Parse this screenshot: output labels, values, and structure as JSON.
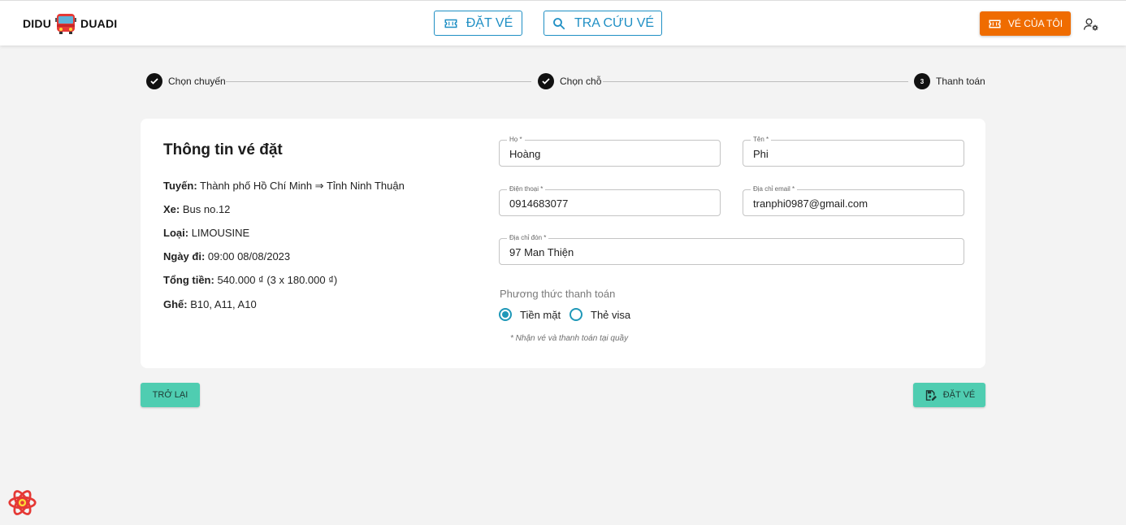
{
  "header": {
    "logo_left": "DIDU",
    "logo_right": "DUADI",
    "btn_book": "ĐẶT VÉ",
    "btn_lookup": "TRA CỨU VÉ",
    "btn_my_tickets": "VÉ CỦA TÔI",
    "colors": {
      "accent_blue": "#1f8fc4",
      "orange": "#ef6c00"
    }
  },
  "stepper": {
    "steps": [
      {
        "label": "Chọn chuyến",
        "status": "done",
        "icon": "check-icon"
      },
      {
        "label": "Chọn chỗ",
        "status": "done",
        "icon": "check-icon"
      },
      {
        "label": "Thanh toán",
        "status": "active",
        "number": "3"
      }
    ]
  },
  "info": {
    "title": "Thông tin vé đặt",
    "rows": [
      {
        "label": "Tuyến:",
        "value": "Thành phố Hồ Chí Minh ⇒ Tỉnh Ninh Thuận"
      },
      {
        "label": "Xe:",
        "value": "Bus no.12"
      },
      {
        "label": "Loại:",
        "value": "LIMOUSINE"
      },
      {
        "label": "Ngày đi:",
        "value": "09:00 08/08/2023"
      },
      {
        "label": "Tổng tiền:",
        "value": "540.000 ₫ (3 x 180.000 ₫)"
      },
      {
        "label": "Ghế:",
        "value": "B10, A11, A10"
      }
    ]
  },
  "form": {
    "last_name": {
      "label": "Họ *",
      "value": "Hoàng"
    },
    "first_name": {
      "label": "Tên *",
      "value": "Phi"
    },
    "phone": {
      "label": "Điện thoại *",
      "value": "0914683077"
    },
    "email": {
      "label": "Địa chỉ email *",
      "value": "tranphi0987@gmail.com"
    },
    "pickup": {
      "label": "Địa chỉ đón *",
      "value": "97 Man Thiện"
    },
    "payment": {
      "label": "Phương thức thanh toán",
      "options": [
        {
          "label": "Tiền mặt",
          "selected": true
        },
        {
          "label": "Thẻ visa",
          "selected": false
        }
      ],
      "note": "* Nhận vé và thanh toán tại quầy"
    }
  },
  "actions": {
    "back": "TRỞ LẠI",
    "submit": "ĐẶT VÉ",
    "color": "#4fcdb1"
  }
}
